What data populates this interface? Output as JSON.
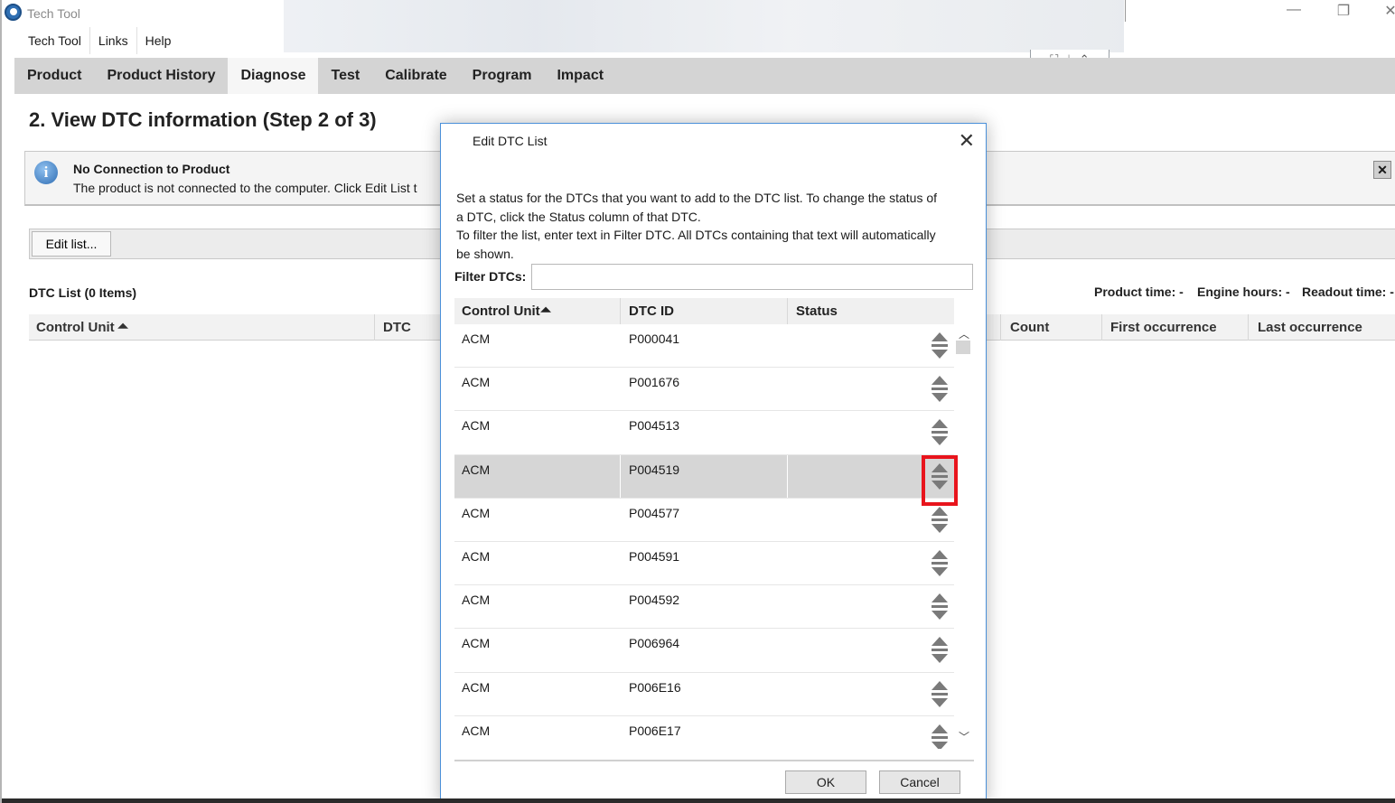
{
  "window": {
    "title": "Tech Tool",
    "controls": {
      "minimize": "—",
      "restore": "❐",
      "close": "✕"
    }
  },
  "menubar": [
    "Tech Tool",
    "Links",
    "Help"
  ],
  "collapse_widget": {
    "icons": [
      "expand-icon",
      "chevron-up-icon"
    ]
  },
  "tabs": [
    {
      "label": "Product",
      "active": false
    },
    {
      "label": "Product History",
      "active": false
    },
    {
      "label": "Diagnose",
      "active": true
    },
    {
      "label": "Test",
      "active": false
    },
    {
      "label": "Calibrate",
      "active": false
    },
    {
      "label": "Program",
      "active": false
    },
    {
      "label": "Impact",
      "active": false
    }
  ],
  "page": {
    "title": "2. View DTC information (Step 2 of 3)",
    "info": {
      "title": "No Connection to Product",
      "message": "The product is not connected to the computer. Click Edit List t"
    },
    "edit_list_button": "Edit list...",
    "dtc_list_label": "DTC List (0 Items)",
    "meta": {
      "product_time": "Product time: -",
      "engine_hours": "Engine hours: -",
      "readout_time": "Readout time: -"
    },
    "columns": [
      "Control Unit",
      "DTC",
      "Count",
      "First occurrence",
      "Last occurrence"
    ]
  },
  "dialog": {
    "title": "Edit DTC List",
    "instructions": [
      "Set a status for the DTCs that you want to add to the DTC list. To change the status of",
      "a DTC, click the Status column of that DTC.",
      "To filter the list, enter text in Filter DTC. All DTCs containing that text will automatically",
      "be shown."
    ],
    "filter_label": "Filter DTCs:",
    "filter_value": "",
    "columns": [
      "Control Unit",
      "DTC ID",
      "Status"
    ],
    "rows": [
      {
        "control_unit": "ACM",
        "dtc_id": "P000041",
        "status": ""
      },
      {
        "control_unit": "ACM",
        "dtc_id": "P001676",
        "status": ""
      },
      {
        "control_unit": "ACM",
        "dtc_id": "P004513",
        "status": ""
      },
      {
        "control_unit": "ACM",
        "dtc_id": "P004519",
        "status": "",
        "selected": true
      },
      {
        "control_unit": "ACM",
        "dtc_id": "P004577",
        "status": ""
      },
      {
        "control_unit": "ACM",
        "dtc_id": "P004591",
        "status": ""
      },
      {
        "control_unit": "ACM",
        "dtc_id": "P004592",
        "status": ""
      },
      {
        "control_unit": "ACM",
        "dtc_id": "P006964",
        "status": ""
      },
      {
        "control_unit": "ACM",
        "dtc_id": "P006E16",
        "status": ""
      },
      {
        "control_unit": "ACM",
        "dtc_id": "P006E17",
        "status": ""
      }
    ],
    "ok_label": "OK",
    "cancel_label": "Cancel"
  },
  "colors": {
    "highlight": "#e8141c",
    "dialog_border": "#4a90d9",
    "tabbar": "#d4d4d4"
  }
}
